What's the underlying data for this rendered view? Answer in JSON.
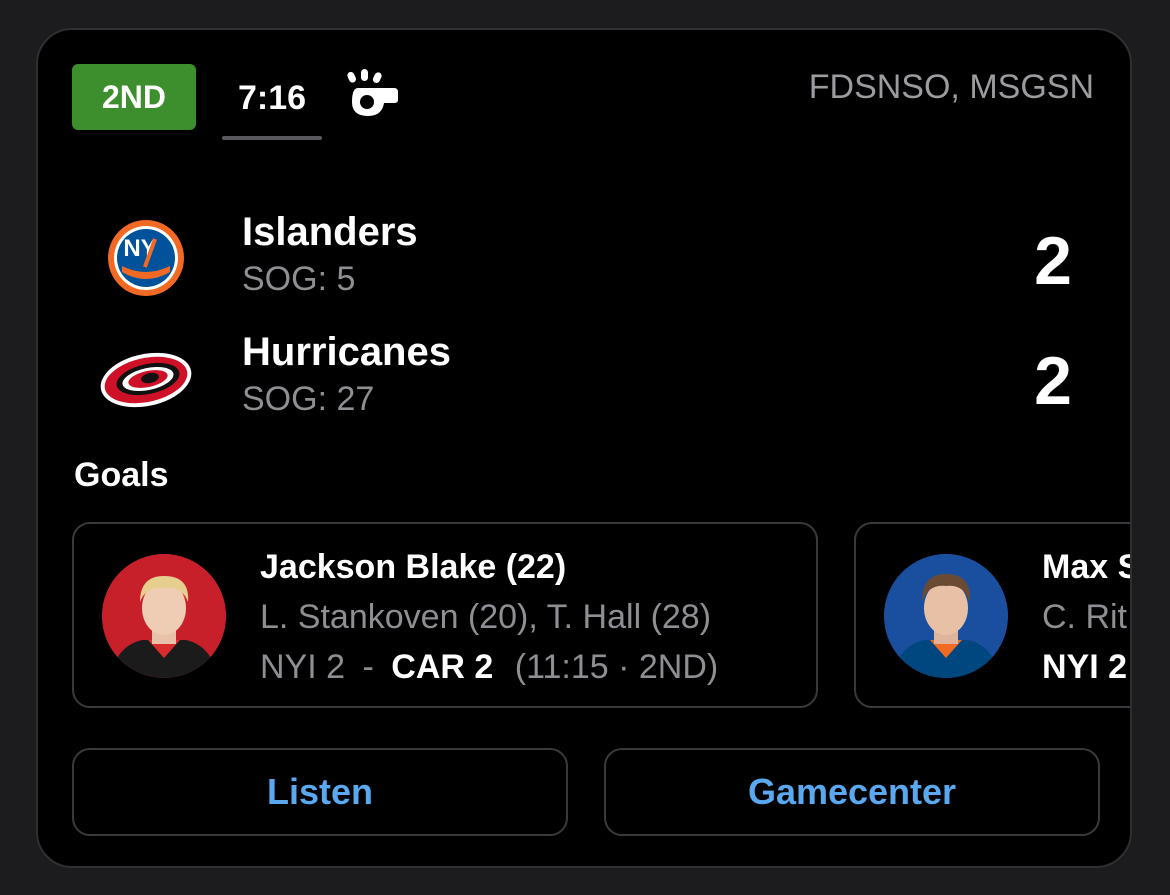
{
  "header": {
    "period": "2ND",
    "clock": "7:16",
    "whistle_icon": "whistle-icon",
    "broadcast": "FDSNSO, MSGSN"
  },
  "teams": [
    {
      "name": "Islanders",
      "sog": "SOG: 5",
      "score": "2",
      "logo": "islanders-logo"
    },
    {
      "name": "Hurricanes",
      "sog": "SOG: 27",
      "score": "2",
      "logo": "hurricanes-logo"
    }
  ],
  "goals": {
    "heading": "Goals",
    "items": [
      {
        "scorer": "Jackson Blake (22)",
        "assists": "L. Stankoven (20), T. Hall (28)",
        "score_away": "NYI 2",
        "separator": "-",
        "score_home": "CAR 2",
        "time": "(11:15 · 2ND)",
        "avatar_color": "#c8202a"
      },
      {
        "scorer": "Max S",
        "assists": "C. Rit",
        "score_away": "NYI 2",
        "avatar_color": "#1a4fa0"
      }
    ]
  },
  "actions": {
    "listen": "Listen",
    "gamecenter": "Gamecenter"
  },
  "colors": {
    "period_badge": "#3d8f2e",
    "link": "#5aa8ef",
    "islanders_orange": "#f26924",
    "islanders_blue": "#00539b",
    "hurricanes_red": "#ce1126"
  }
}
